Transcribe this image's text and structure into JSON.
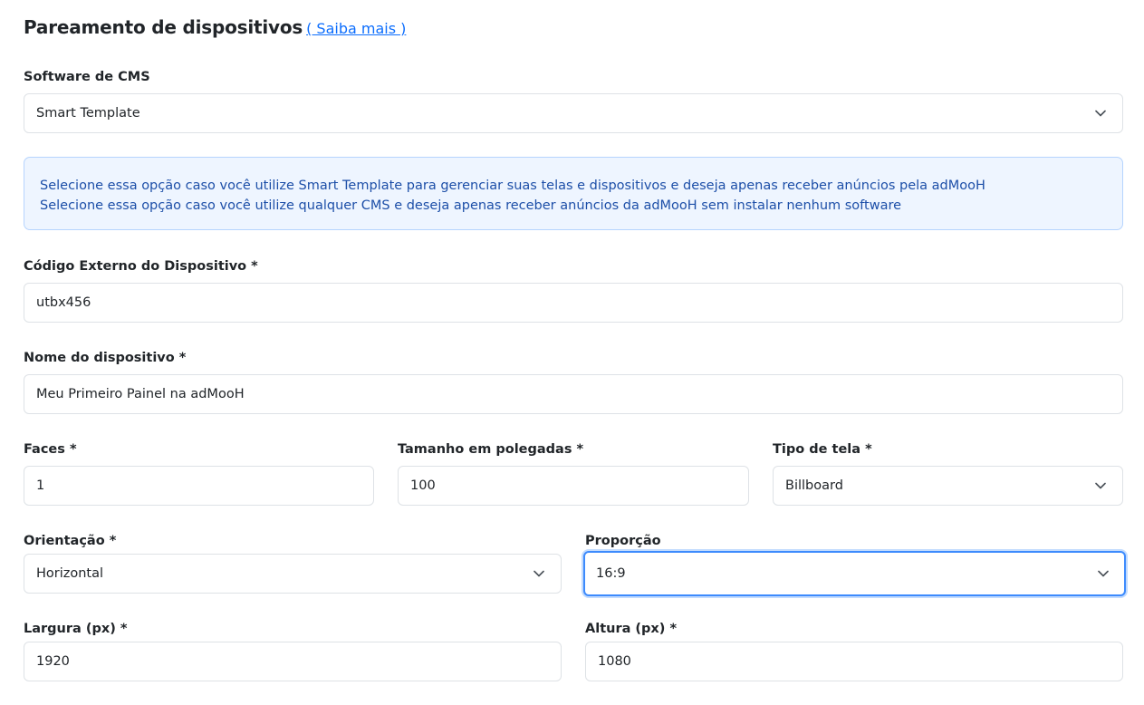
{
  "header": {
    "title": "Pareamento de dispositivos",
    "learn_more": "( Saiba mais )"
  },
  "cms": {
    "label": "Software de CMS",
    "value": "Smart Template"
  },
  "info": {
    "line1": "Selecione essa opção caso você utilize Smart Template para gerenciar suas telas e dispositivos e deseja apenas receber anúncios pela adMooH",
    "line2": "Selecione essa opção caso você utilize qualquer CMS e deseja apenas receber anúncios da adMooH sem instalar nenhum software"
  },
  "external_code": {
    "label": "Código Externo do Dispositivo *",
    "value": "utbx456"
  },
  "device_name": {
    "label": "Nome do dispositivo *",
    "value": "Meu Primeiro Painel na adMooH"
  },
  "faces": {
    "label": "Faces *",
    "value": "1"
  },
  "size_inches": {
    "label": "Tamanho em polegadas *",
    "value": "100"
  },
  "screen_type": {
    "label": "Tipo de tela *",
    "value": "Billboard"
  },
  "orientation": {
    "label": "Orientação *",
    "value": "Horizontal"
  },
  "ratio": {
    "label": "Proporção",
    "value": "16:9"
  },
  "width": {
    "label": "Largura (px) *",
    "value": "1920"
  },
  "height": {
    "label": "Altura (px) *",
    "value": "1080"
  },
  "icons": {
    "select_chevron": "chevron-down-icon"
  },
  "colors": {
    "link": "#0d6efd",
    "info_bg": "#eef5ff",
    "info_border": "#b6d4fe",
    "info_text": "#1d4fa8",
    "focus_border": "#3d8bfd"
  }
}
